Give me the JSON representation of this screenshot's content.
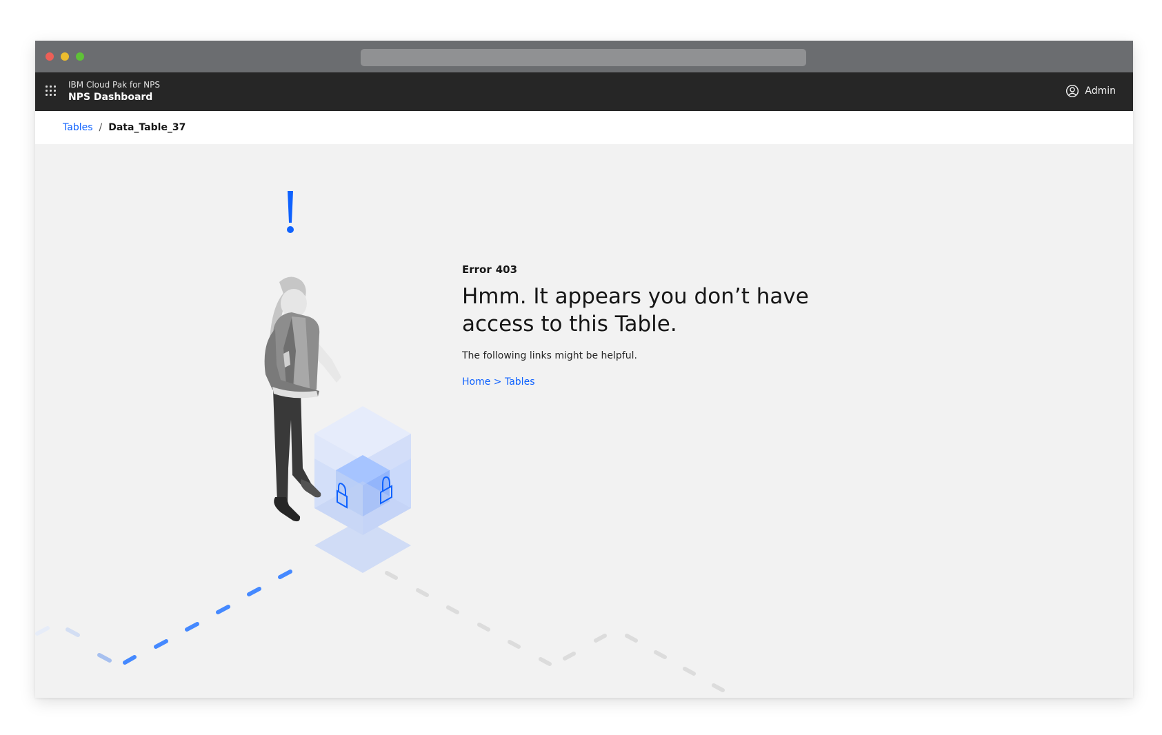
{
  "app": {
    "product_subtitle": "IBM Cloud Pak for NPS",
    "product_name": "NPS Dashboard",
    "user_label": "Admin"
  },
  "breadcrumb": {
    "parent": "Tables",
    "separator": "/",
    "current": "Data_Table_37"
  },
  "error": {
    "code_label": "Error",
    "code": "403",
    "title_line1": "Hmm. It appears you don’t have",
    "title_line2": "access to this Table.",
    "help_text": "The following links might be helpful.",
    "link_home": "Home",
    "link_separator": ">",
    "link_tables": "Tables"
  },
  "illustration": {
    "exclamation": "!",
    "icons": [
      "exclamation-icon",
      "lock-icon",
      "lock-icon"
    ]
  },
  "colors": {
    "accent": "#0f62fe",
    "header_bg": "#262626",
    "page_bg": "#f2f2f2"
  }
}
